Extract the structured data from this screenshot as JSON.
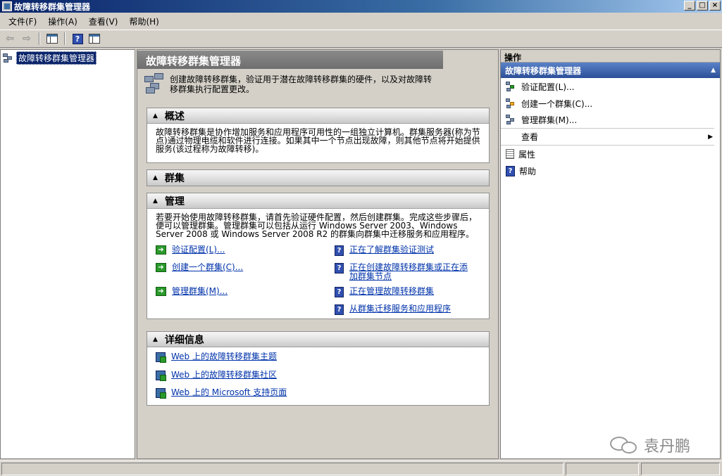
{
  "window": {
    "title": "故障转移群集管理器"
  },
  "menu": [
    "文件(F)",
    "操作(A)",
    "查看(V)",
    "帮助(H)"
  ],
  "tree": {
    "root_label": "故障转移群集管理器"
  },
  "main": {
    "header": "故障转移群集管理器",
    "intro": "创建故障转移群集，验证用于潜在故障转移群集的硬件，以及对故障转移群集执行配置更改。",
    "overview": {
      "title": "概述",
      "body": "故障转移群集是协作增加服务和应用程序可用性的一组独立计算机。群集服务器(称为节点)通过物理电缆和软件进行连接。如果其中一个节点出现故障，则其他节点将开始提供服务(该过程称为故障转移)。"
    },
    "clusters": {
      "title": "群集"
    },
    "management": {
      "title": "管理",
      "body": "若要开始使用故障转移群集，请首先验证硬件配置，然后创建群集。完成这些步骤后，便可以管理群集。管理群集可以包括从运行 Windows Server 2003、Windows Server 2008 或 Windows Server 2008 R2 的群集向群集中迁移服务和应用程序。",
      "actions": [
        "验证配置(L)...",
        "创建一个群集(C)...",
        "管理群集(M)..."
      ],
      "help_links": [
        "正在了解群集验证测试",
        "正在创建故障转移群集或正在添加群集节点",
        "正在管理故障转移群集",
        "从群集迁移服务和应用程序"
      ]
    },
    "details": {
      "title": "详细信息",
      "links": [
        "Web 上的故障转移群集主题",
        "Web 上的故障转移群集社区",
        "Web 上的 Microsoft 支持页面"
      ]
    }
  },
  "actions_pane": {
    "title": "操作",
    "group": "故障转移群集管理器",
    "items": [
      "验证配置(L)...",
      "创建一个群集(C)...",
      "管理群集(M)...",
      "查看",
      "属性",
      "帮助"
    ]
  },
  "watermark": {
    "text": "袁丹鹏"
  }
}
